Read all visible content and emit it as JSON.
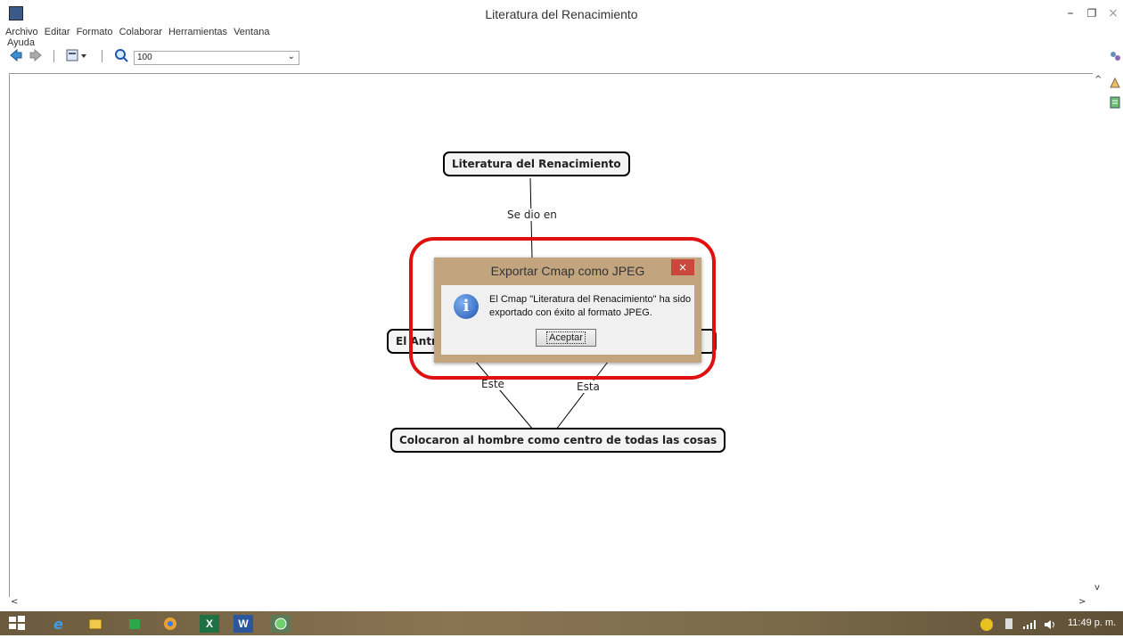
{
  "window": {
    "title": "Literatura del Renacimiento",
    "minimize": "–",
    "restore": "❐",
    "close": "×"
  },
  "menu": {
    "items": [
      "Archivo",
      "Editar",
      "Formato",
      "Colaborar",
      "Herramientas",
      "Ventana",
      "Ayuda"
    ]
  },
  "toolbar": {
    "zoom_value": "100",
    "zoom_arrow": "⌄"
  },
  "map": {
    "root": "Literatura del Renacimiento",
    "link_root": "Se dio en",
    "left_node_partial": "El Antr",
    "right_node_partial": "o",
    "link_left": "Este",
    "link_right": "Esta",
    "bottom": "Colocaron al hombre como centro de todas las cosas"
  },
  "dialog": {
    "title": "Exportar Cmap como JPEG",
    "close": "×",
    "message": "El Cmap \"Literatura del Renacimiento\" ha sido exportado con éxito al formato JPEG.",
    "accept": "Aceptar",
    "info_glyph": "i"
  },
  "scroll": {
    "up": "^",
    "down": "v",
    "left": "<",
    "right": ">"
  },
  "taskbar": {
    "clock": "11:49 p. m.",
    "apps": [
      "start-icon",
      "internet-explorer-icon",
      "file-explorer-icon",
      "store-icon",
      "chrome-icon",
      "excel-icon",
      "word-icon",
      "cmaptools-icon"
    ],
    "excel_glyph": "X",
    "word_glyph": "W"
  },
  "colors": {
    "highlight": "#e01010",
    "dialog_frame": "#c2a47e",
    "dialog_close": "#c9473c",
    "taskbar": "#7a6a4a"
  }
}
